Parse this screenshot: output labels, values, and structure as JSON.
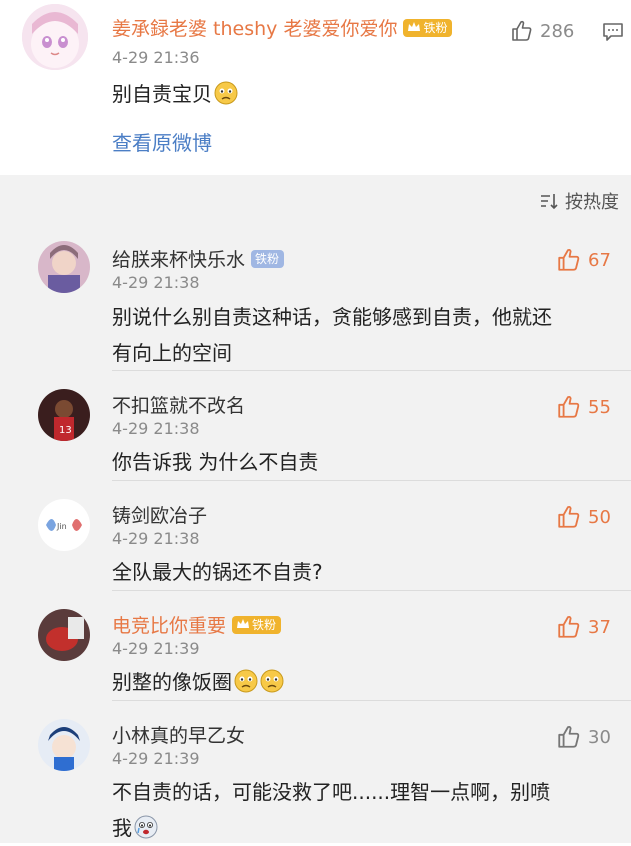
{
  "post": {
    "author": "姜承録老婆 theshy 老婆爱你爱你",
    "badge": "铁粉",
    "time": "4-29 21:36",
    "text": "别自责宝贝",
    "likes": "286",
    "view_original": "查看原微博",
    "colors": {
      "author": "#e77845",
      "link": "#4b7ec5"
    }
  },
  "sort": {
    "label": "按热度",
    "icon": "sort-icon"
  },
  "comments": [
    {
      "name": "给朕来杯快乐水",
      "badge": "铁粉",
      "badge_type": "fan",
      "time": "4-29 21:38",
      "text_line1": "别说什么别自责这种话，贪能够感到自责，他就还",
      "text_line2": "有向上的空间",
      "likes": "67"
    },
    {
      "name": "不扣篮就不改名",
      "time": "4-29 21:38",
      "text": "你告诉我 为什么不自责",
      "likes": "55"
    },
    {
      "name": "铸剑欧冶子",
      "time": "4-29 21:38",
      "text": "全队最大的锅还不自责?",
      "likes": "50"
    },
    {
      "name": "电竞比你重要",
      "badge": "铁粉",
      "badge_type": "vip",
      "time": "4-29 21:39",
      "text": "别整的像饭圈",
      "likes": "37"
    },
    {
      "name": "小林真的早乙女",
      "time": "4-29 21:39",
      "text_line1": "不自责的话，可能没救了吧......理智一点啊，别喷",
      "text_line2": "我",
      "likes": "30"
    }
  ]
}
